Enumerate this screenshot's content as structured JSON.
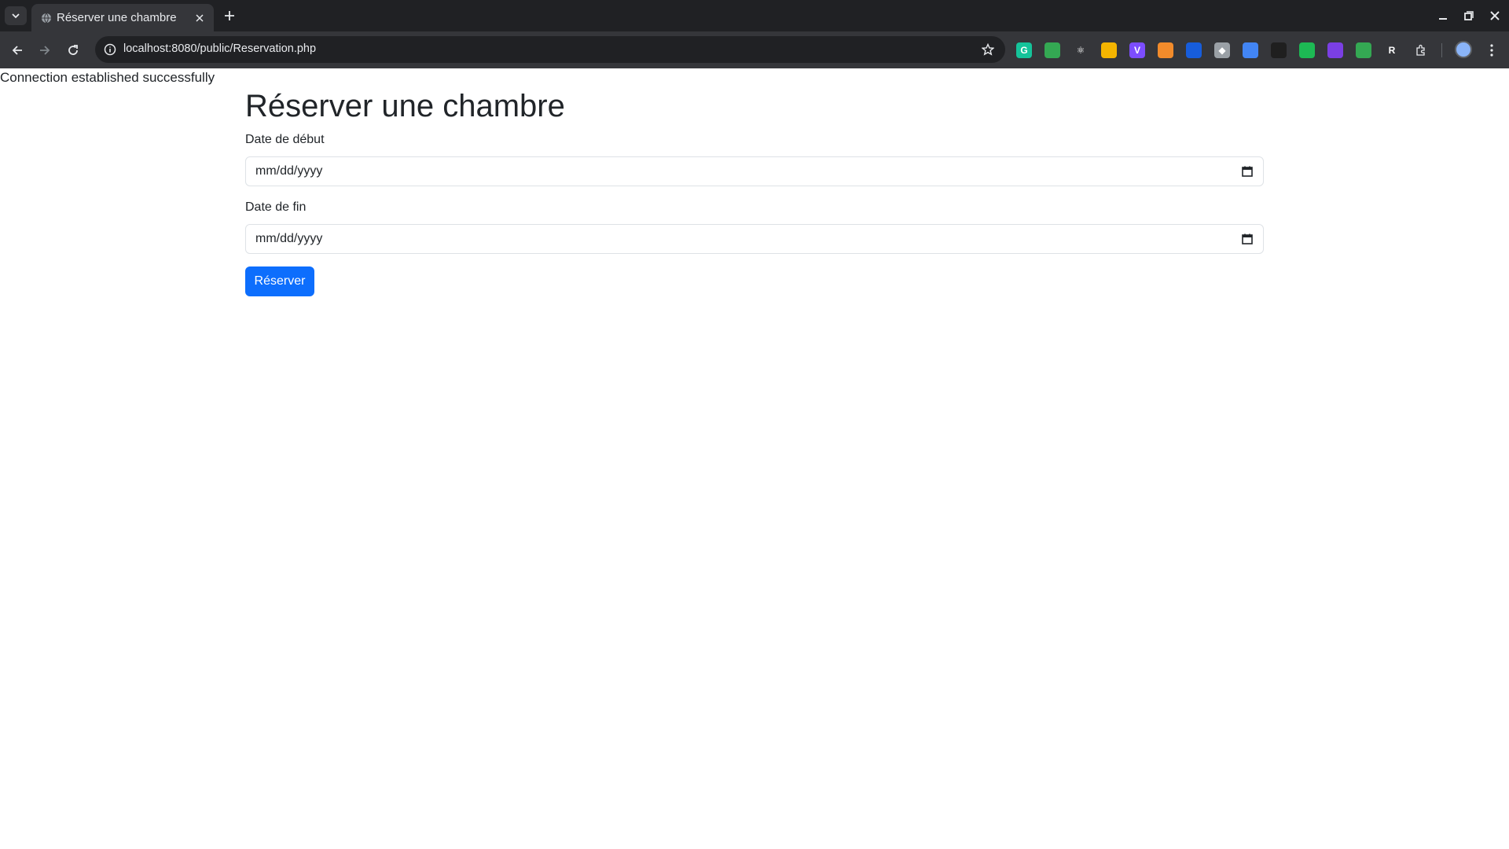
{
  "browser": {
    "tab_title": "Réserver une chambre",
    "url": "localhost:8080/public/Reservation.php",
    "extensions": [
      {
        "name": "grammarly-icon",
        "color": "#15c39a",
        "glyph": "G"
      },
      {
        "name": "shield-extension-icon",
        "color": "#34a853",
        "glyph": ""
      },
      {
        "name": "react-devtools-icon",
        "color": "#35363a",
        "glyph": "⚛"
      },
      {
        "name": "colorful-grid-extension-icon",
        "color": "#f4b400",
        "glyph": ""
      },
      {
        "name": "vue-extension-icon",
        "color": "#7c4dff",
        "glyph": "V"
      },
      {
        "name": "ember-extension-icon",
        "color": "#f28b2b",
        "glyph": ""
      },
      {
        "name": "bitwarden-extension-icon",
        "color": "#175ddc",
        "glyph": ""
      },
      {
        "name": "git-extension-icon",
        "color": "#9aa0a6",
        "glyph": "◆"
      },
      {
        "name": "ring-extension-icon",
        "color": "#4285f4",
        "glyph": ""
      },
      {
        "name": "dark-extension-icon",
        "color": "#1f1f1f",
        "glyph": ""
      },
      {
        "name": "green-eye-extension-icon",
        "color": "#1db954",
        "glyph": ""
      },
      {
        "name": "purple-hex-extension-icon",
        "color": "#7b3fe4",
        "glyph": ""
      },
      {
        "name": "mail-extension-icon",
        "color": "#34a853",
        "glyph": ""
      },
      {
        "name": "r-extension-icon",
        "color": "#35363a",
        "glyph": "R"
      }
    ]
  },
  "page": {
    "connection_message": "Connection established successfully",
    "title": "Réserver une chambre",
    "start_label": "Date de début",
    "start_value": "mm/dd/yyyy",
    "end_label": "Date de fin",
    "end_value": "mm/dd/yyyy",
    "submit_label": "Réserver",
    "accent_color": "#0d6efd"
  }
}
